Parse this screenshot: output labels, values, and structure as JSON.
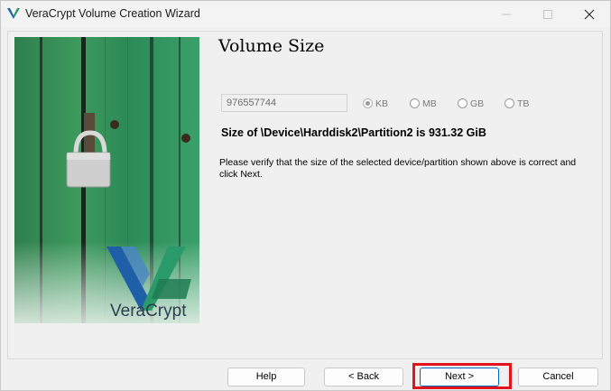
{
  "window": {
    "title": "VeraCrypt Volume Creation Wizard",
    "icon": "veracrypt-logo-icon"
  },
  "graphic": {
    "brand": "VeraCrypt"
  },
  "page": {
    "heading": "Volume Size",
    "size_value": "976557744",
    "units": [
      {
        "label": "KB",
        "selected": true
      },
      {
        "label": "MB",
        "selected": false
      },
      {
        "label": "GB",
        "selected": false
      },
      {
        "label": "TB",
        "selected": false
      }
    ],
    "size_summary": "Size of \\Device\\Harddisk2\\Partition2 is 931.32 GiB",
    "info": "Please verify that the size of the selected device/partition shown above is correct and click Next."
  },
  "buttons": {
    "help": "Help",
    "back": "< Back",
    "next": "Next >",
    "cancel": "Cancel"
  },
  "colors": {
    "accent": "#0067c0",
    "highlight": "#e1141b"
  }
}
